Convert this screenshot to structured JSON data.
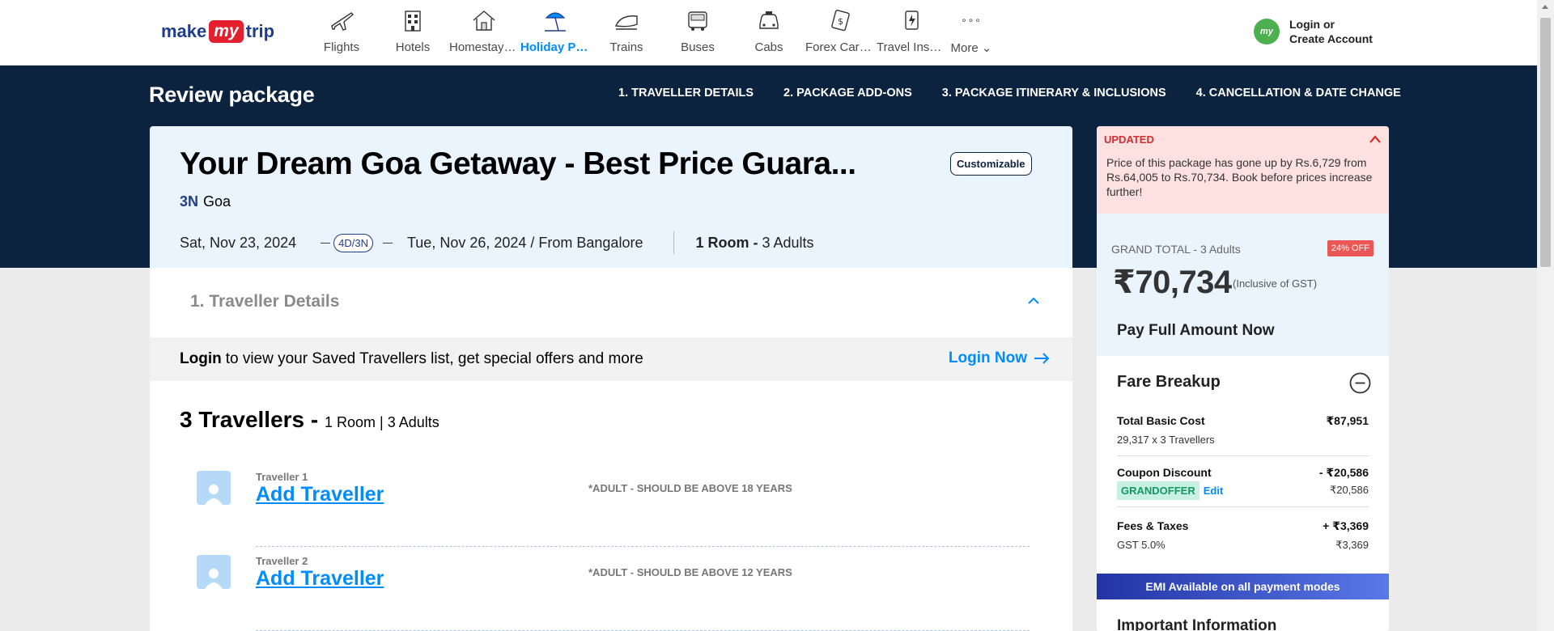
{
  "header": {
    "logo": {
      "pre": "make",
      "mid": "my",
      "post": "trip"
    },
    "nav": [
      {
        "label": "Flights",
        "icon": "flight-icon"
      },
      {
        "label": "Hotels",
        "icon": "hotel-icon"
      },
      {
        "label": "Homestays & Villas",
        "icon": "homestay-icon"
      },
      {
        "label": "Holiday Packages",
        "icon": "holiday-icon",
        "active": true
      },
      {
        "label": "Trains",
        "icon": "train-icon"
      },
      {
        "label": "Buses",
        "icon": "bus-icon"
      },
      {
        "label": "Cabs",
        "icon": "cab-icon"
      },
      {
        "label": "Forex Card & Currency",
        "icon": "forex-icon"
      },
      {
        "label": "Travel Insurance",
        "icon": "insurance-icon"
      }
    ],
    "more_label": "More",
    "login_line1": "Login or",
    "login_line2": "Create Account",
    "avatar_text": "my"
  },
  "band": {
    "title": "Review package",
    "steps": [
      "1. TRAVELLER DETAILS",
      "2. PACKAGE ADD-ONS",
      "3. PACKAGE ITINERARY & INCLUSIONS",
      "4. CANCELLATION & DATE CHANGE"
    ]
  },
  "package": {
    "title": "Your Dream Goa Getaway - Best Price Guara...",
    "badge": "Customizable",
    "nights": "3N",
    "destination": "Goa",
    "start_date": "Sat, Nov 23, 2024",
    "duration": "4D/3N",
    "end_date": "Tue, Nov 26, 2024 / From Bangalore",
    "rooms_bold": "1 Room -",
    "rooms_rest": "3 Adults"
  },
  "traveller_section": {
    "heading": "1. Traveller Details",
    "login_bold": "Login",
    "login_text": "to view your Saved Travellers list, get special offers and more",
    "login_now": "Login Now",
    "count_bold": "3 Travellers -",
    "count_rest": "1 Room | 3 Adults",
    "travellers": [
      {
        "label": "Traveller 1",
        "action": "Add Traveller",
        "note": "*ADULT - SHOULD BE ABOVE 18 YEARS"
      },
      {
        "label": "Traveller 2",
        "action": "Add Traveller",
        "note": "*ADULT - SHOULD BE ABOVE 12 YEARS"
      }
    ]
  },
  "price": {
    "updated_label": "UPDATED",
    "updated_text": "Price of this package has gone up by Rs.6,729 from Rs.64,005 to Rs.70,734. Book before prices increase further!",
    "grand_total_label": "GRAND TOTAL - 3 Adults",
    "discount_badge": "24% OFF",
    "amount": "₹70,734",
    "gst_note": "(Inclusive of GST)",
    "pay_label": "Pay Full Amount Now",
    "fare_heading": "Fare Breakup",
    "basic_label": "Total Basic Cost",
    "basic_value": "₹87,951",
    "basic_sub": "29,317 x 3 Travellers",
    "coupon_label": "Coupon Discount",
    "coupon_value": "- ₹20,586",
    "coupon_code": "GRANDOFFER",
    "coupon_edit": "Edit",
    "coupon_sub_value": "₹20,586",
    "fees_label": "Fees & Taxes",
    "fees_value": "+ ₹3,369",
    "gst_label": "GST 5.0%",
    "gst_value": "₹3,369",
    "emi_text": "EMI Available on all payment modes",
    "important_heading": "Important Information"
  },
  "colors": {
    "navy": "#0c2340",
    "accent_blue": "#008cff",
    "alert_red": "#d32f2f",
    "coupon_green": "#129862"
  }
}
